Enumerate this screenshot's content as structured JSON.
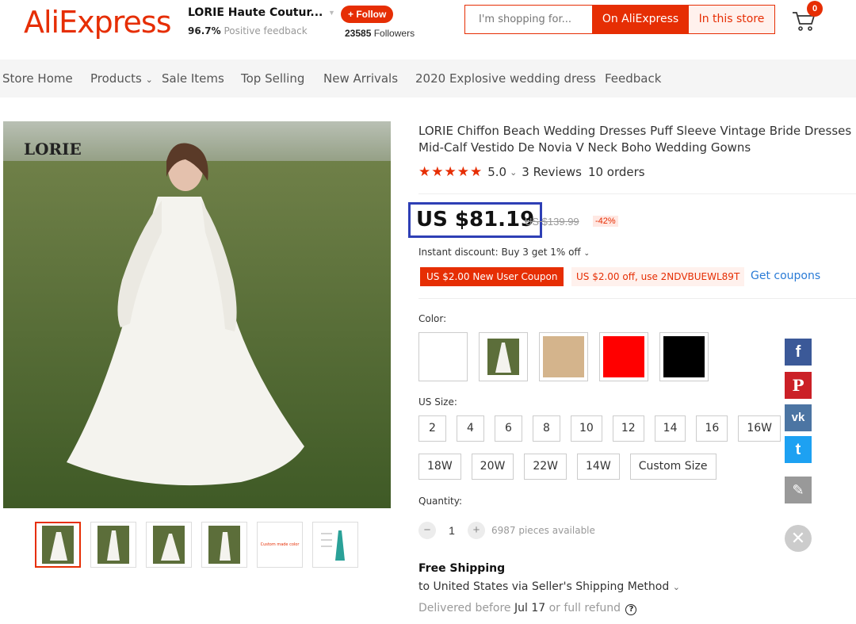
{
  "header": {
    "logo": "AliExpress",
    "store_name": "LORIE Haute Coutur...",
    "feedback_pct": "96.7%",
    "feedback_label": "Positive feedback",
    "follow_label": "+ Follow",
    "followers_count": "23585",
    "followers_label": "Followers",
    "search_placeholder": "I'm shopping for...",
    "search_ali": "On AliExpress",
    "search_store": "In this store",
    "cart_count": "0"
  },
  "nav": [
    "Store Home",
    "Products",
    "Sale Items",
    "Top Selling",
    "New Arrivals",
    "2020 Explosive wedding dress",
    "Feedback"
  ],
  "gallery": {
    "watermark": "LORIE",
    "thumbs": [
      "dress-1",
      "dress-2",
      "dress-3",
      "dress-4",
      "custom-color-note",
      "size-chart"
    ],
    "custom_title": "Custom made color"
  },
  "product": {
    "title": "LORIE Chiffon Beach Wedding Dresses Puff Sleeve Vintage Bride Dresses Mid-Calf Vestido De Novia V Neck Boho Wedding Gowns",
    "stars": "★★★★★",
    "rating": "5.0",
    "reviews": "3 Reviews",
    "orders": "10 orders",
    "price": "US $81.19",
    "old_price": "US $139.99",
    "discount": "-42%",
    "instant_discount": "Instant discount: Buy 3 get 1% off",
    "coupon_new_user": "US $2.00 New User Coupon",
    "coupon_code": "US $2.00 off, use 2NDVBUEWL89T",
    "get_coupons": "Get coupons",
    "color_label": "Color:",
    "colors": [
      "#ffffff",
      "photo",
      "#d4b48c",
      "#ff0000",
      "#000000"
    ],
    "size_label": "US Size:",
    "sizes_row1": [
      "2",
      "4",
      "6",
      "8",
      "10",
      "12",
      "14",
      "16",
      "16W"
    ],
    "sizes_row2": [
      "18W",
      "20W",
      "22W",
      "14W",
      "Custom Size"
    ],
    "quantity_label": "Quantity:",
    "quantity": "1",
    "available": "6987 pieces available",
    "shipping_title": "Free Shipping",
    "shipping_to": "to United States via Seller's Shipping Method",
    "delivery_prefix": "Delivered before",
    "delivery_date": "Jul 17",
    "delivery_suffix": "or full refund"
  },
  "social": [
    {
      "name": "facebook-icon",
      "glyph": "f",
      "color": "#3b5998"
    },
    {
      "name": "pinterest-icon",
      "glyph": "P",
      "color": "#cb2027"
    },
    {
      "name": "vk-icon",
      "glyph": "vk",
      "color": "#4c75a3"
    },
    {
      "name": "twitter-icon",
      "glyph": "t",
      "color": "#1da1f2"
    },
    {
      "name": "edit-icon",
      "glyph": "✎",
      "color": "#999999"
    }
  ]
}
